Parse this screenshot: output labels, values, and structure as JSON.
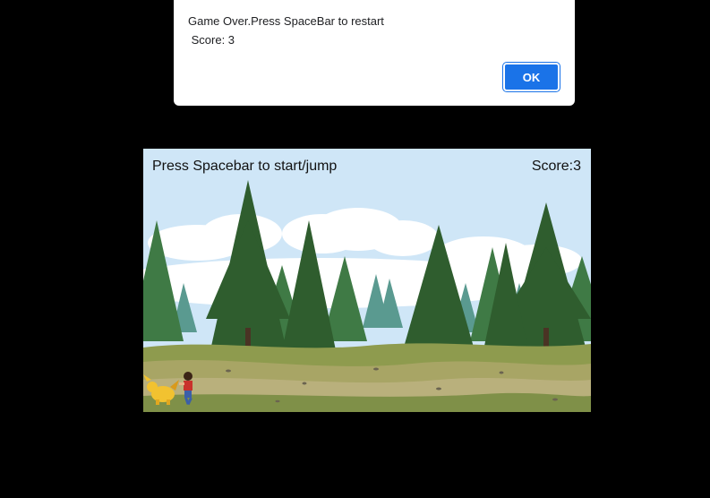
{
  "alert": {
    "message_line1": "Game Over.Press SpaceBar to restart",
    "message_line2": " Score: 3",
    "ok_label": "OK"
  },
  "game": {
    "instruction": "Press Spacebar to start/jump",
    "score_label": "Score:3",
    "scene": {
      "sky_color": "#cfe6f7",
      "cloud_color": "#ffffff",
      "tree_dark_color": "#2f5d2e",
      "tree_mid_color": "#3f7a45",
      "tree_teal_color": "#4e8f86",
      "ground_color": "#9a9d56",
      "path_color": "#b5ad78"
    },
    "characters": [
      "runner-boy",
      "yellow-creature"
    ]
  },
  "colors": {
    "background": "#000000",
    "accent": "#1a73e8"
  }
}
